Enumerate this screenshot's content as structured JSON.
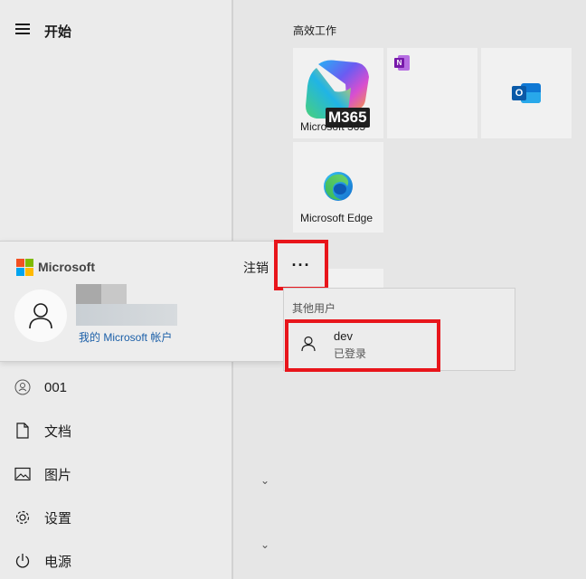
{
  "start": {
    "title": "开始"
  },
  "group": {
    "title": "高效工作"
  },
  "tiles": [
    {
      "name": "Microsoft 365",
      "badge": "M365"
    },
    {
      "name": ""
    },
    {
      "name": ""
    },
    {
      "name": "Microsoft Edge"
    }
  ],
  "account": {
    "brand": "Microsoft",
    "signout_label": "注销",
    "link_label": "我的 Microsoft 帐户",
    "more_label": "···"
  },
  "other_users": {
    "title": "其他用户",
    "users": [
      {
        "name": "dev",
        "status": "已登录"
      }
    ]
  },
  "nav": [
    {
      "label": "001",
      "icon": "user-icon"
    },
    {
      "label": "文档",
      "icon": "document-icon"
    },
    {
      "label": "图片",
      "icon": "pictures-icon"
    },
    {
      "label": "设置",
      "icon": "gear-icon"
    },
    {
      "label": "电源",
      "icon": "power-icon"
    }
  ],
  "colors": {
    "highlight": "#e8151b",
    "link": "#1b5fa8"
  }
}
